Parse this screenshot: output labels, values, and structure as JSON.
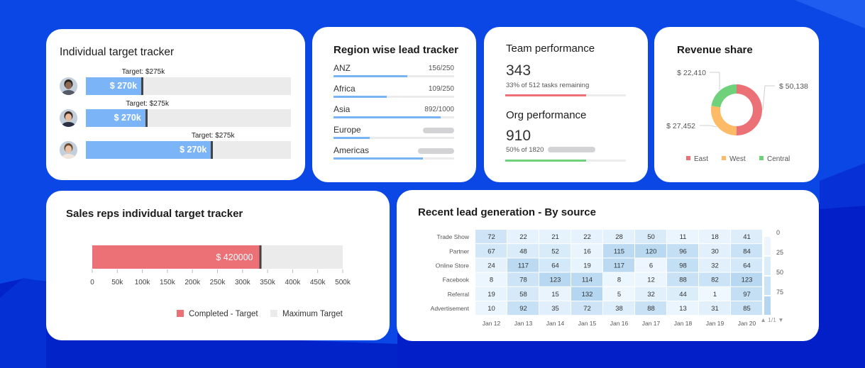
{
  "colors": {
    "background": "#0a3fe0",
    "background_dark": "#0320c8",
    "blue_bar": "#7cb5f7",
    "region_bar": "#78b3f4",
    "red": "#ec7176",
    "orange": "#fdbb68",
    "green": "#6fd27a",
    "track": "#ebebeb",
    "marker": "#444444"
  },
  "individual_tracker": {
    "title": "Individual target tracker",
    "reps": [
      {
        "avatar": "avatar-man-beard",
        "target_label": "Target: $275k",
        "value_label": "$ 270k",
        "progress": 0.27,
        "target_pos": 0.28
      },
      {
        "avatar": "avatar-woman-dark-hair",
        "target_label": "Target: $275k",
        "value_label": "$ 270k",
        "progress": 0.29,
        "target_pos": 0.3
      },
      {
        "avatar": "avatar-woman-light-hair",
        "target_label": "Target: $275k",
        "value_label": "$ 270k",
        "progress": 0.61,
        "target_pos": 0.62
      }
    ]
  },
  "region_tracker": {
    "title": "Region wise lead tracker",
    "regions": [
      {
        "name": "ANZ",
        "value": "156/250",
        "progress": 0.61,
        "loading": false
      },
      {
        "name": "Africa",
        "value": "109/250",
        "progress": 0.44,
        "loading": false
      },
      {
        "name": "Asia",
        "value": "892/1000",
        "progress": 0.89,
        "loading": false
      },
      {
        "name": "Europe",
        "value": "",
        "progress": 0.3,
        "loading": true
      },
      {
        "name": "Americas",
        "value": "",
        "progress": 0.74,
        "loading": true
      }
    ]
  },
  "team_performance": {
    "title": "Team performance",
    "value": "343",
    "subtitle": "33% of 512 tasks remaining",
    "progress": 0.67,
    "color": "#ec7176"
  },
  "org_performance": {
    "title": "Org performance",
    "value": "910",
    "subtitle": "50% of 1820",
    "progress": 0.67,
    "color": "#6fd27a",
    "loading": true
  },
  "revenue_share": {
    "title": "Revenue share",
    "chart_data": {
      "type": "pie",
      "variant": "donut",
      "title": "Revenue share",
      "slices": [
        {
          "name": "East",
          "value": 50138,
          "label": "$ 50,138",
          "color": "#ec7176"
        },
        {
          "name": "West",
          "value": 27452,
          "label": "$ 27,452",
          "color": "#fdbb68"
        },
        {
          "name": "Central",
          "value": 22410,
          "label": "$ 22,410",
          "color": "#6fd27a"
        }
      ],
      "legend": [
        "East",
        "West",
        "Central"
      ],
      "legend_position": "bottom"
    }
  },
  "sales_reps": {
    "title": "Sales reps individual target tracker",
    "chart_data": {
      "type": "bar",
      "orientation": "horizontal",
      "title": "Sales reps individual target tracker",
      "series": [
        {
          "name": "Completed - Target",
          "value": 335000,
          "color": "#ec7176"
        },
        {
          "name": "Maximum Target",
          "value": 500000,
          "color": "#ebebeb"
        }
      ],
      "target_marker": 335000,
      "data_label": "$ 420000",
      "xlim": [
        0,
        500000
      ],
      "ticks": [
        "0",
        "50k",
        "100k",
        "150k",
        "200k",
        "250k",
        "300k",
        "350k",
        "400k",
        "450k",
        "500k"
      ],
      "legend": [
        "Completed - Target",
        "Maximum Target"
      ],
      "legend_position": "bottom-right"
    }
  },
  "lead_generation": {
    "title": "Recent lead generation - By source",
    "chart_data": {
      "type": "heatmap",
      "title": "Recent lead generation - By source",
      "rows": [
        "Trade Show",
        "Partner",
        "Online Store",
        "Facebook",
        "Referral",
        "Advertisement"
      ],
      "columns": [
        "Jan 12",
        "Jan 13",
        "Jan 14",
        "Jan 15",
        "Jan 16",
        "Jan 17",
        "Jan 18",
        "Jan 19",
        "Jan 20"
      ],
      "values": [
        [
          72,
          22,
          21,
          22,
          28,
          50,
          11,
          18,
          41
        ],
        [
          67,
          48,
          52,
          16,
          115,
          120,
          96,
          30,
          84
        ],
        [
          24,
          117,
          64,
          19,
          117,
          6,
          98,
          32,
          64
        ],
        [
          8,
          78,
          123,
          114,
          8,
          12,
          88,
          82,
          123
        ],
        [
          19,
          58,
          15,
          132,
          5,
          32,
          44,
          1,
          97
        ],
        [
          10,
          92,
          35,
          72,
          38,
          88,
          13,
          31,
          85
        ]
      ],
      "scale_labels": [
        "0",
        "25",
        "50",
        "75"
      ],
      "pager": "1/1"
    }
  }
}
